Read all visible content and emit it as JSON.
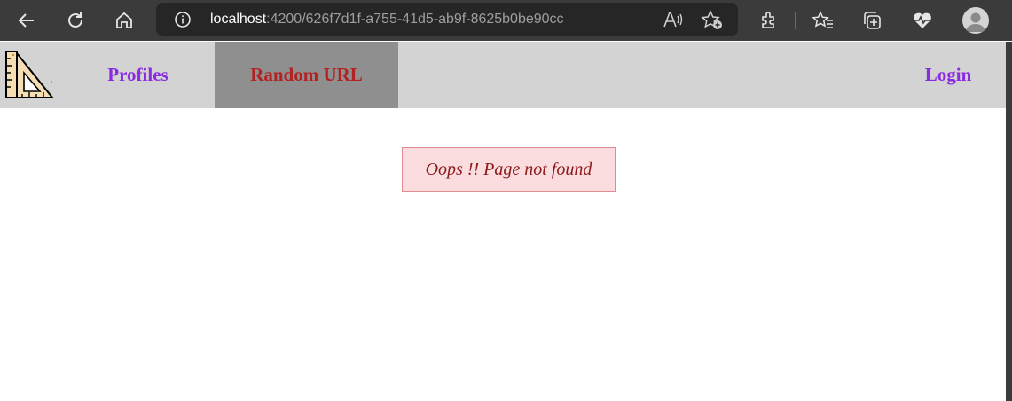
{
  "browser": {
    "url_host": "localhost",
    "url_rest": ":4200/626f7d1f-a755-41d5-ab9f-8625b0be90cc",
    "icons": [
      "back-icon",
      "refresh-icon",
      "home-icon",
      "site-info-icon",
      "read-aloud-icon",
      "add-favorite-icon",
      "extensions-icon",
      "favorites-icon",
      "collections-icon",
      "browser-essentials-icon",
      "profile-avatar-icon"
    ],
    "colors": {
      "chrome": "#3b3b3b",
      "address_bar": "#262626"
    }
  },
  "nav": {
    "links": [
      {
        "label": "Profiles"
      },
      {
        "label": "Random URL",
        "active": true
      },
      {
        "label": "Login"
      }
    ],
    "colors": {
      "background": "#d3d3d3",
      "link": "#8a2be2",
      "active_bg": "#8f8f8f",
      "active_text": "#b22222"
    }
  },
  "error": {
    "message": "Oops !! Page not found",
    "colors": {
      "background": "#fbdde0",
      "border": "#e08a92",
      "text": "#8b1a1a"
    }
  }
}
